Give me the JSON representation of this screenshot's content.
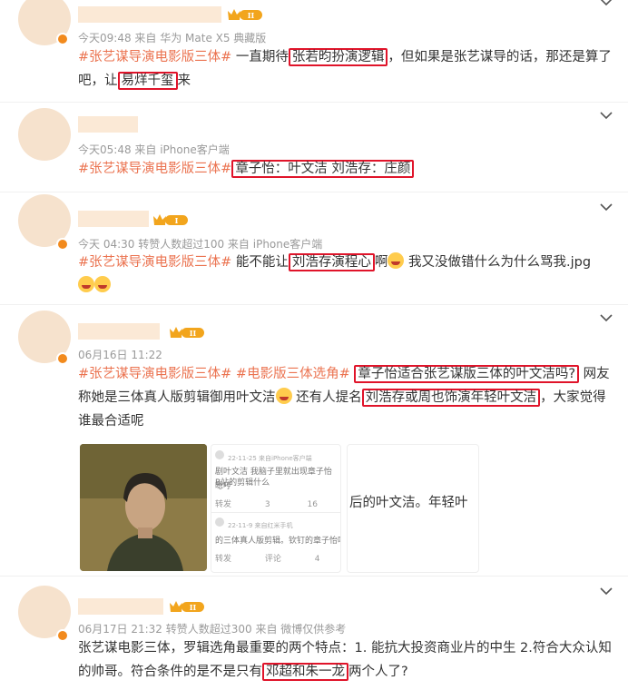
{
  "posts": [
    {
      "meta": "今天09:48  来自 华为 Mate X5 典藏版",
      "badge": "II",
      "segments": [
        {
          "t": "#张艺谋导演电影版三体#",
          "tag": true
        },
        {
          "t": " 一直期待"
        },
        {
          "t": "张若昀扮演逻辑",
          "hl": true
        },
        {
          "t": "，但如果是张艺谋导的话，那还是算了吧，让"
        },
        {
          "t": "易烊千玺",
          "hl": true
        },
        {
          "t": "来"
        }
      ]
    },
    {
      "meta": "今天05:48  来自 iPhone客户端",
      "segments": [
        {
          "t": "#张艺谋导演电影版三体#",
          "tag": true
        },
        {
          "t": "章子怡：叶文洁 刘浩存：庄颜",
          "hl": true
        }
      ]
    },
    {
      "meta": "今天 04:30  转赞人数超过100  来自 iPhone客户端",
      "badge": "I",
      "segments": [
        {
          "t": "#张艺谋导演电影版三体#",
          "tag": true
        },
        {
          "t": " 能不能让"
        },
        {
          "t": "刘浩存演程心",
          "hl": true
        },
        {
          "t": "啊"
        },
        {
          "emoji": "喜"
        },
        {
          "t": " 我又没做错什么为什么骂我.jpg "
        },
        {
          "emoji": "喜"
        },
        {
          "emoji": "喜"
        }
      ]
    },
    {
      "meta": "06月16日 11:22",
      "badge": "II",
      "segments": [
        {
          "t": "#张艺谋导演电影版三体#",
          "tag": true
        },
        {
          "t": " "
        },
        {
          "t": "#电影版三体选角#",
          "tag": true
        },
        {
          "t": " "
        },
        {
          "t": "章子怡适合张艺谋版三体的叶文洁吗?",
          "hl": true
        },
        {
          "t": " 网友称她是三体真人版剪辑御用叶文洁"
        },
        {
          "emoji": "呆"
        },
        {
          "t": " 还有人提名"
        },
        {
          "t": "刘浩存或周也饰演年轻叶文洁",
          "hl": true
        },
        {
          "t": "，大家觉得谁最合适呢"
        }
      ],
      "images": {
        "card1": {
          "meta": "22-11-25 来自iPhone客户端",
          "text": "剧叶文洁 我脑子里就出现章子怡 B站的剪辑什么",
          "text2": "嗯哼",
          "actions": [
            "转发",
            "3",
            "16"
          ]
        },
        "card2": {
          "meta": "22-11-9 来自红米手机",
          "text": "的三体真人版剪辑。钦钉的章子怡叶文洁",
          "actions": [
            "转发",
            "评论",
            "4"
          ]
        },
        "card3": {
          "text": "后的叶文洁。年轻叶"
        }
      }
    },
    {
      "meta": "06月17日 21:32  转赞人数超过300  来自 微博仅供参考",
      "badge": "II",
      "segments": [
        {
          "t": "张艺谋电影三体，罗辑选角最重要的两个特点：1. 能抗大投资商业片的中生 2.符合大众认知的帅哥。符合条件的是不是只有"
        },
        {
          "t": "邓超和朱一龙",
          "hl": true
        },
        {
          "t": "两个人了?"
        }
      ]
    }
  ],
  "colors": {
    "tag": "#eb7350",
    "highlight": "#e0142a",
    "meta": "#9a9a9a"
  }
}
